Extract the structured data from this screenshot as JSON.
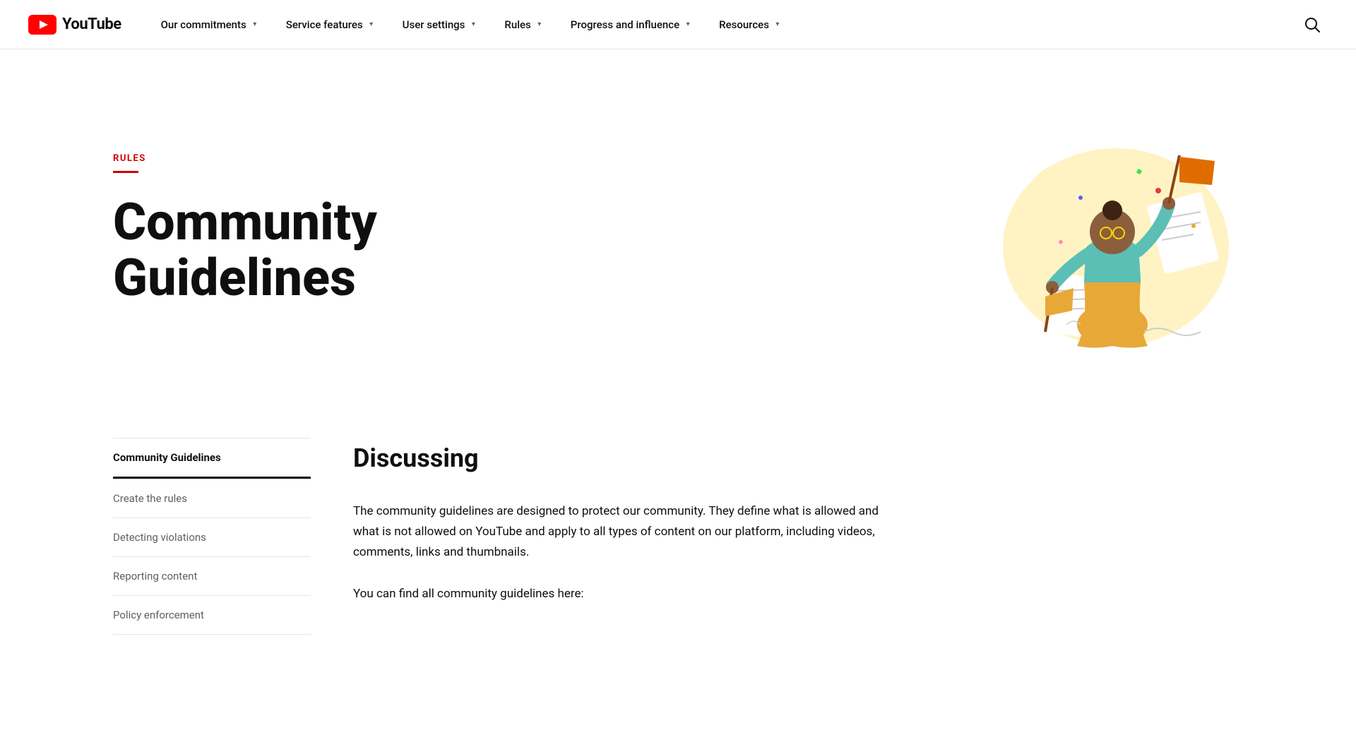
{
  "logo": {
    "text": "YouTube"
  },
  "nav": {
    "items": [
      {
        "label": "Our commitments",
        "key": "our-commitments"
      },
      {
        "label": "Service features",
        "key": "service-features"
      },
      {
        "label": "User settings",
        "key": "user-settings"
      },
      {
        "label": "Rules",
        "key": "rules"
      },
      {
        "label": "Progress and influence",
        "key": "progress-and-influence"
      },
      {
        "label": "Resources",
        "key": "resources"
      }
    ]
  },
  "hero": {
    "section_label": "RULES",
    "title": "Community Guidelines"
  },
  "sidebar": {
    "items": [
      {
        "label": "Community Guidelines",
        "active": true
      },
      {
        "label": "Create the rules",
        "active": false
      },
      {
        "label": "Detecting violations",
        "active": false
      },
      {
        "label": "Reporting content",
        "active": false
      },
      {
        "label": "Policy enforcement",
        "active": false
      }
    ]
  },
  "article": {
    "section_title": "Discussing",
    "paragraphs": [
      "The community guidelines are designed to protect our community. They define what is allowed and what is not allowed on YouTube and apply to all types of content on our platform, including videos, comments, links and thumbnails.",
      "You can find all community guidelines here:"
    ]
  }
}
